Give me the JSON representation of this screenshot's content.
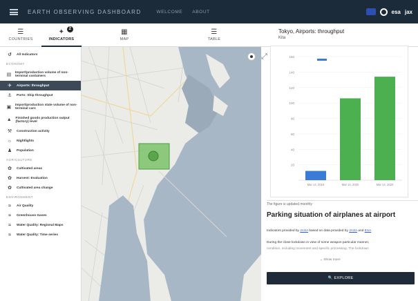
{
  "header": {
    "app_title": "EARTH OBSERVING DASHBOARD",
    "nav": [
      "WELCOME",
      "ABOUT"
    ],
    "logo": "esa",
    "logo_tail": "jax"
  },
  "tools": [
    {
      "label": "COUNTRIES",
      "icon": "hamburger-icon"
    },
    {
      "label": "INDICATORS",
      "icon": "satellite-icon",
      "badge": "2"
    },
    {
      "label": "MAP",
      "icon": "map-icon"
    },
    {
      "label": "TABLE",
      "icon": "table-icon"
    }
  ],
  "sidebar": {
    "all_label": "All Indicators",
    "section_economy": "ECONOMY",
    "section_agriculture": "AGRICULTURE",
    "section_environment": "ENVIRONMENT",
    "items": [
      {
        "label": "Import/production volume of non-terminal containers",
        "icon": "container-icon",
        "tall": true
      },
      {
        "label": "Airports: throughput",
        "icon": "airplane-icon",
        "active": true
      },
      {
        "label": "Ports: Ship throughput",
        "icon": "ship-icon"
      },
      {
        "label": "Import/production state volume of non-terminal cars",
        "icon": "car-icon",
        "tall": true
      },
      {
        "label": "Finished goods production output (factory) level",
        "icon": "factory-icon",
        "tall": true
      },
      {
        "label": "Construction activity",
        "icon": "construction-icon"
      },
      {
        "label": "Nightlights",
        "icon": "light-icon"
      },
      {
        "label": "Population",
        "icon": "people-icon"
      },
      {
        "label": "Cultivated areas",
        "icon": "leaf-icon"
      },
      {
        "label": "Harvest: Evaluation",
        "icon": "leaf-icon"
      },
      {
        "label": "Cultivated area change",
        "icon": "leaf-icon"
      },
      {
        "label": "Air Quality",
        "icon": "wind-icon"
      },
      {
        "label": "Greenhouse Gases",
        "icon": "wind-icon"
      },
      {
        "label": "Water Quality: Regional Maps",
        "icon": "water-icon"
      },
      {
        "label": "Water Quality: Time series",
        "icon": "water-icon"
      }
    ]
  },
  "panel": {
    "title": "Tokyo, Airports: throughput",
    "subtitle": "Kita",
    "below_chart": "The figure is updated monthly",
    "heading": "Parking situation of airplanes at airport",
    "p1_pre": "Indicators provided by ",
    "p1_link1": "JAXA",
    "p1_mid": " based on data provided by ",
    "p1_link2": "JAXA",
    "p1_end": " and ",
    "p1_link3": "ESA",
    "p2": "During the close lockdown in view of some weapon particular manner,",
    "p3": "condition, including movement and specific processing. The lockdown",
    "show_more": "Show more",
    "explore": "EXPLORE"
  },
  "chart_data": {
    "type": "bar",
    "categories": [
      "Mar 14, 2019",
      "Mar 14, 2020",
      "Mar 14, 2020"
    ],
    "values": [
      12,
      106,
      134
    ],
    "colors": [
      "#3a7bd5",
      "#4caf50",
      "#4caf50"
    ],
    "reference_value": 156,
    "ylim": [
      0,
      160
    ],
    "yticks": [
      20,
      40,
      60,
      80,
      100,
      120,
      140,
      160
    ]
  }
}
